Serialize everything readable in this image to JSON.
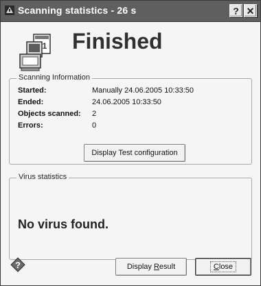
{
  "window": {
    "title": "Scanning statistics - 26 s",
    "help_label": "?",
    "close_label": "✕"
  },
  "status": {
    "title": "Finished"
  },
  "scanning_information": {
    "legend": "Scanning Information",
    "rows": [
      {
        "label": "Started:",
        "value": "Manually 24.06.2005 10:33:50"
      },
      {
        "label": "Ended:",
        "value": "24.06.2005 10:33:50"
      },
      {
        "label": "Objects scanned:",
        "value": "2"
      },
      {
        "label": "Errors:",
        "value": "0"
      }
    ],
    "config_button": "Display Test configuration"
  },
  "virus_statistics": {
    "legend": "Virus statistics",
    "message": "No virus found."
  },
  "footer": {
    "result_button_pre": "Display ",
    "result_button_underlined": "R",
    "result_button_post": "esult",
    "close_button_underlined": "C",
    "close_button_post": "lose"
  }
}
